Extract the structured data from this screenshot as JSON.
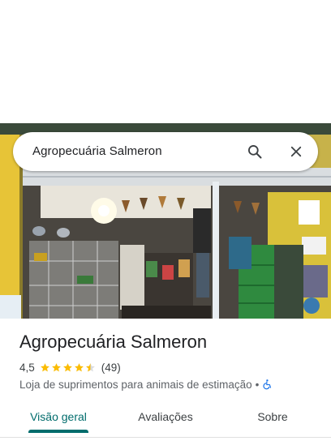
{
  "search": {
    "query": "Agropecuária Salmeron"
  },
  "place": {
    "name": "Agropecuária Salmeron",
    "rating": "4,5",
    "stars_filled": 4.5,
    "review_count": "(49)",
    "category": "Loja de suprimentos para animais de estimação",
    "separator": "•"
  },
  "tabs": [
    {
      "label": "Visão geral",
      "active": true
    },
    {
      "label": "Avaliações",
      "active": false
    },
    {
      "label": "Sobre",
      "active": false
    }
  ],
  "colors": {
    "accent": "#006c6c",
    "star": "#fbbc04",
    "wheelchair": "#1a73e8"
  },
  "icons": {
    "search": "search-icon",
    "close": "close-icon",
    "accessibility": "wheelchair-icon"
  }
}
